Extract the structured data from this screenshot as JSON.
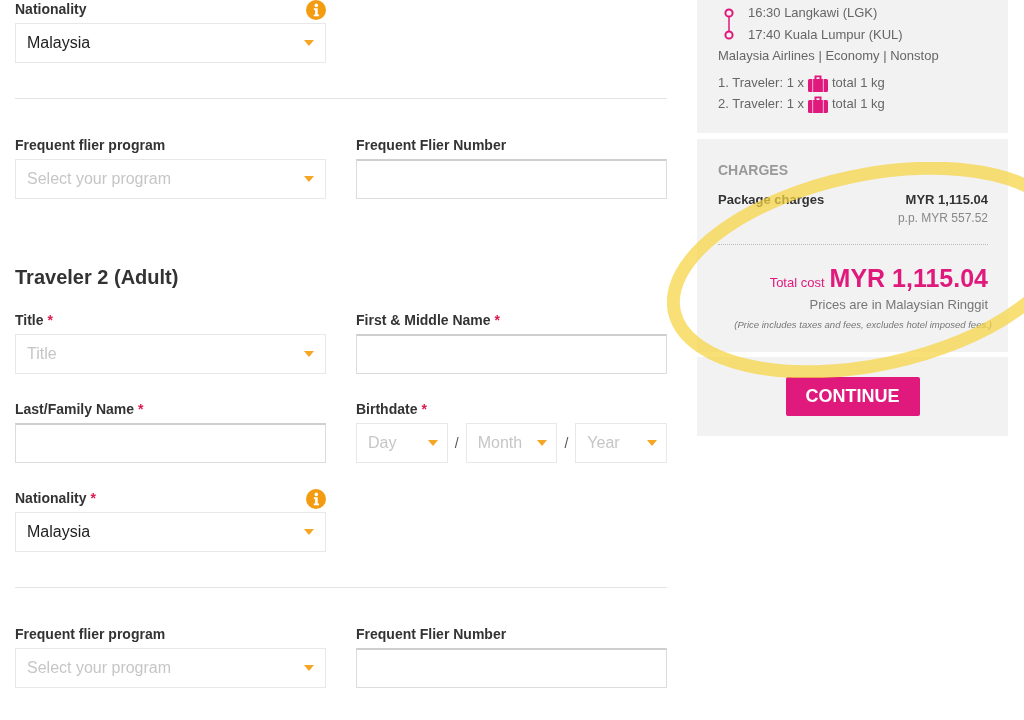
{
  "form": [
    {
      "kind": "row",
      "fields": [
        {
          "kind": "select",
          "label": "Nationality",
          "info": true,
          "value": "Malaysia"
        }
      ]
    },
    {
      "kind": "divider"
    },
    {
      "kind": "row",
      "fields": [
        {
          "kind": "select",
          "label": "Frequent flier program",
          "info": false,
          "placeholder": "Select your program"
        },
        {
          "kind": "text",
          "label": "Frequent Flier Number",
          "info": false
        }
      ]
    },
    {
      "kind": "heading",
      "text": "Traveler 2 (Adult)"
    },
    {
      "kind": "row",
      "fields": [
        {
          "kind": "select",
          "label": "Title",
          "required_mark": "*",
          "info": false,
          "placeholder": "Title"
        },
        {
          "kind": "text",
          "label": "First & Middle Name",
          "required_mark": "*",
          "info": false
        }
      ]
    },
    {
      "kind": "row",
      "fields": [
        {
          "kind": "text",
          "label": "Last/Family Name",
          "required_mark": "*",
          "info": false
        },
        {
          "kind": "date",
          "label": "Birthdate",
          "required_mark": "*",
          "info": false,
          "parts": [
            {
              "kind": "select",
              "placeholder": "Day"
            },
            {
              "kind": "separator",
              "text": "/"
            },
            {
              "kind": "select",
              "placeholder": "Month"
            },
            {
              "kind": "separator",
              "text": "/"
            },
            {
              "kind": "select",
              "placeholder": "Year"
            }
          ]
        }
      ]
    },
    {
      "kind": "row",
      "fields": [
        {
          "kind": "select",
          "label": "Nationality",
          "required_mark": "*",
          "info": true,
          "value": "Malaysia"
        }
      ]
    },
    {
      "kind": "divider"
    },
    {
      "kind": "row",
      "fields": [
        {
          "kind": "select",
          "label": "Frequent flier program",
          "info": false,
          "placeholder": "Select your program"
        },
        {
          "kind": "text",
          "label": "Frequent Flier Number",
          "info": false
        }
      ]
    }
  ],
  "summary": {
    "flight": {
      "departure": "16:30 Langkawi (LGK)",
      "arrival": "17:40 Kuala Lumpur (KUL)",
      "details": "Malaysia Airlines | Economy | Nonstop"
    },
    "baggage": [
      {
        "count": "1. Traveler: 1 x",
        "weight": "total 1 kg"
      },
      {
        "count": "2. Traveler: 1 x",
        "weight": "total 1 kg"
      }
    ],
    "charges": {
      "heading": "CHARGES",
      "items": [
        {
          "label": "Package charges",
          "amount": "MYR 1,115.04",
          "per_person": "p.p. MYR 557.52"
        }
      ],
      "total_label": "Total cost",
      "total": "MYR 1,115.04",
      "currency_note": "Prices are in Malaysian Ringgit",
      "fine_print": "(Price includes taxes and fees, excludes hotel imposed fees.)"
    },
    "continue_button": "CONTINUE"
  },
  "annotation": {
    "kind": "ellipse"
  }
}
